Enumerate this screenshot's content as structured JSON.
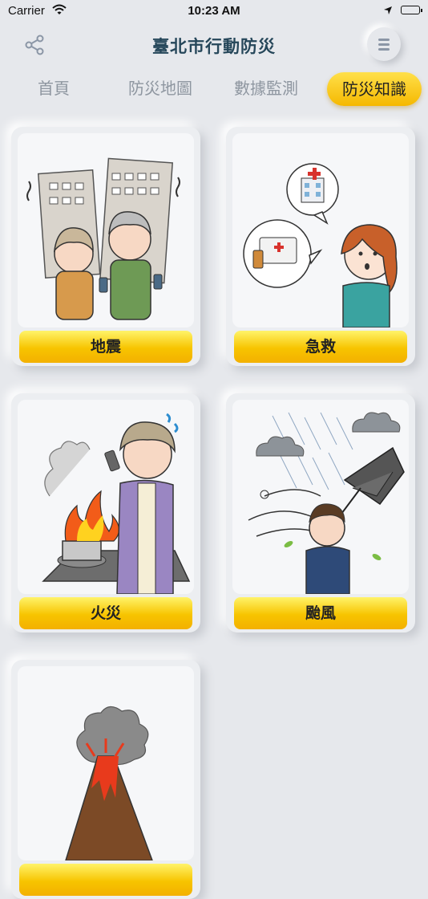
{
  "status_bar": {
    "carrier": "Carrier",
    "time": "10:23 AM"
  },
  "header": {
    "title": "臺北市行動防災"
  },
  "tabs": [
    {
      "label": "首頁",
      "active": false
    },
    {
      "label": "防災地圖",
      "active": false
    },
    {
      "label": "數據監測",
      "active": false
    },
    {
      "label": "防災知識",
      "active": true
    }
  ],
  "cards": [
    {
      "label": "地震",
      "icon": "earthquake-illustration"
    },
    {
      "label": "急救",
      "icon": "first-aid-illustration"
    },
    {
      "label": "火災",
      "icon": "fire-illustration"
    },
    {
      "label": "颱風",
      "icon": "typhoon-illustration"
    },
    {
      "label": "",
      "icon": "volcano-illustration"
    }
  ],
  "colors": {
    "accent": "#f5b800",
    "title": "#26475a",
    "tab_inactive": "#8e96a0",
    "background": "#e6e8ec"
  }
}
